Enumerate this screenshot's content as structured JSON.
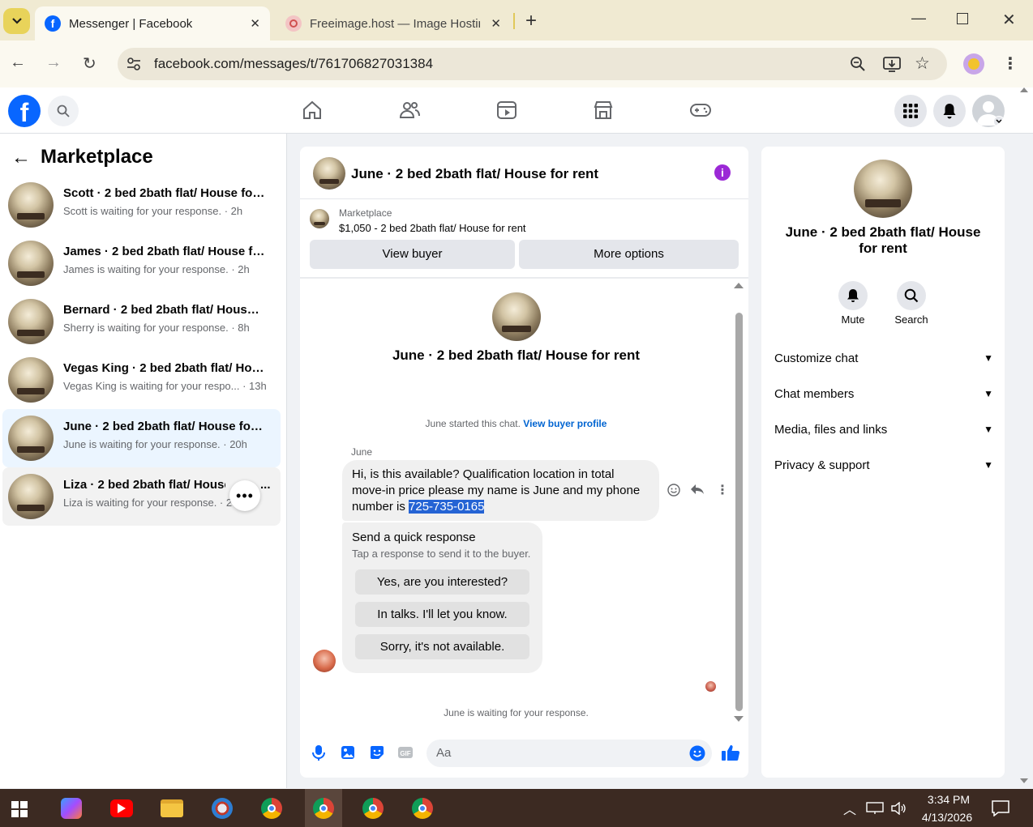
{
  "browser": {
    "tabs": [
      {
        "title": "Messenger | Facebook",
        "active": true
      },
      {
        "title": "Freeimage.host — Image Hostin",
        "active": false
      }
    ],
    "url": "facebook.com/messages/t/761706827031384"
  },
  "sidebar": {
    "title": "Marketplace",
    "conversations": [
      {
        "title": "Scott · 2 bed 2bath flat/ House for...",
        "sub": "Scott is waiting for your response. · 2h"
      },
      {
        "title": "James · 2 bed 2bath flat/ House fo...",
        "sub": "James is waiting for your response. · 2h"
      },
      {
        "title": "Bernard · 2 bed 2bath flat/ House ...",
        "sub": "Sherry is waiting for your response. · 8h"
      },
      {
        "title": "Vegas King · 2 bed 2bath flat/ Hou...",
        "sub": "Vegas King is waiting for your respo... · 13h"
      },
      {
        "title": "June · 2 bed 2bath flat/ House for ...",
        "sub": "June is waiting for your response. · 20h"
      },
      {
        "title": "Liza · 2 bed 2bath flat/ House f",
        "title_tail": "...",
        "sub": "Liza is waiting for your response. · 20"
      }
    ]
  },
  "chat": {
    "header_name": "June · 2 bed 2bath flat/ House for rent",
    "marketplace_label": "Marketplace",
    "listing": "$1,050 - 2 bed 2bath flat/ House for rent",
    "view_buyer": "View buyer",
    "more_options": "More options",
    "center_name": "June · 2 bed 2bath flat/ House for rent",
    "started_text": "June started this chat.",
    "view_buyer_profile": "View buyer profile",
    "sender": "June",
    "message_part1": "Hi, is this available? Qualification location in total move-in price please my name is June  and my phone number is ",
    "message_phone": "725-735-0165",
    "quick_response_title": "Send a quick response",
    "quick_response_sub": "Tap a response to send it to the buyer.",
    "quick_responses": [
      "Yes, are you interested?",
      "In talks. I'll let you know.",
      "Sorry, it's not available."
    ],
    "waiting_text": "June is waiting for your response.",
    "composer_placeholder": "Aa"
  },
  "info": {
    "name": "June · 2 bed 2bath flat/ House for rent",
    "actions": [
      "Mute",
      "Search"
    ],
    "sections": [
      "Customize chat",
      "Chat members",
      "Media, files and links",
      "Privacy & support"
    ]
  },
  "taskbar": {
    "time": "3:34 PM",
    "date": "4/13/2026"
  },
  "colors": {
    "brand": "#0866ff",
    "accent_purple": "#9b28d6",
    "selection": "#2463d4"
  }
}
